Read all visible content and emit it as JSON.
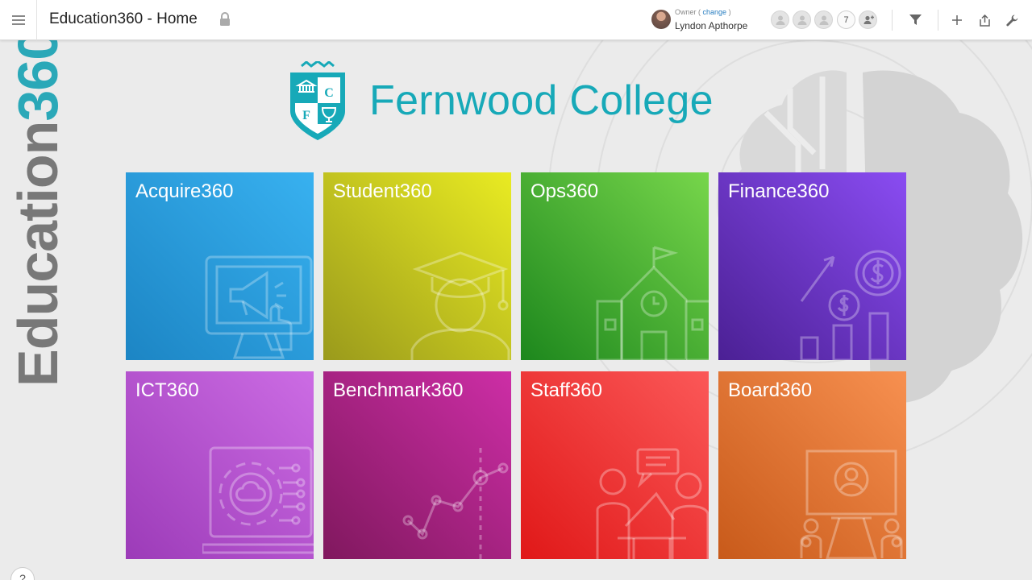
{
  "header": {
    "title": "Education360 - Home",
    "owner_label": "Owner",
    "change_label": "change",
    "owner_name": "Lyndon Apthorpe",
    "member_count": "7",
    "icons": [
      "hamburger-menu-icon",
      "lock-icon",
      "add-member-icon",
      "filter-icon",
      "plus-icon",
      "share-icon",
      "wrench-icon"
    ]
  },
  "brand": {
    "side_word": "Education",
    "side_number": "360"
  },
  "college": {
    "name": "Fernwood College",
    "crest_letters": [
      "C",
      "F"
    ]
  },
  "tiles": [
    {
      "label": "Acquire360",
      "icon": "megaphone-icon"
    },
    {
      "label": "Student360",
      "icon": "graduate-icon"
    },
    {
      "label": "Ops360",
      "icon": "school-building-icon"
    },
    {
      "label": "Finance360",
      "icon": "finance-growth-icon"
    },
    {
      "label": "ICT360",
      "icon": "cloud-gear-icon"
    },
    {
      "label": "Benchmark360",
      "icon": "line-graph-icon"
    },
    {
      "label": "Staff360",
      "icon": "meeting-icon"
    },
    {
      "label": "Board360",
      "icon": "presentation-icon"
    }
  ],
  "help": {
    "label": "?"
  },
  "colors": {
    "brand_teal": "#17a9b8",
    "acquire": "#2a9fe0",
    "student": "#c9c91f",
    "ops": "#4caf35",
    "finance": "#6a36c8",
    "ict": "#b556d2",
    "benchmark": "#a8237f",
    "staff": "#f03a3a",
    "board": "#e47434"
  }
}
